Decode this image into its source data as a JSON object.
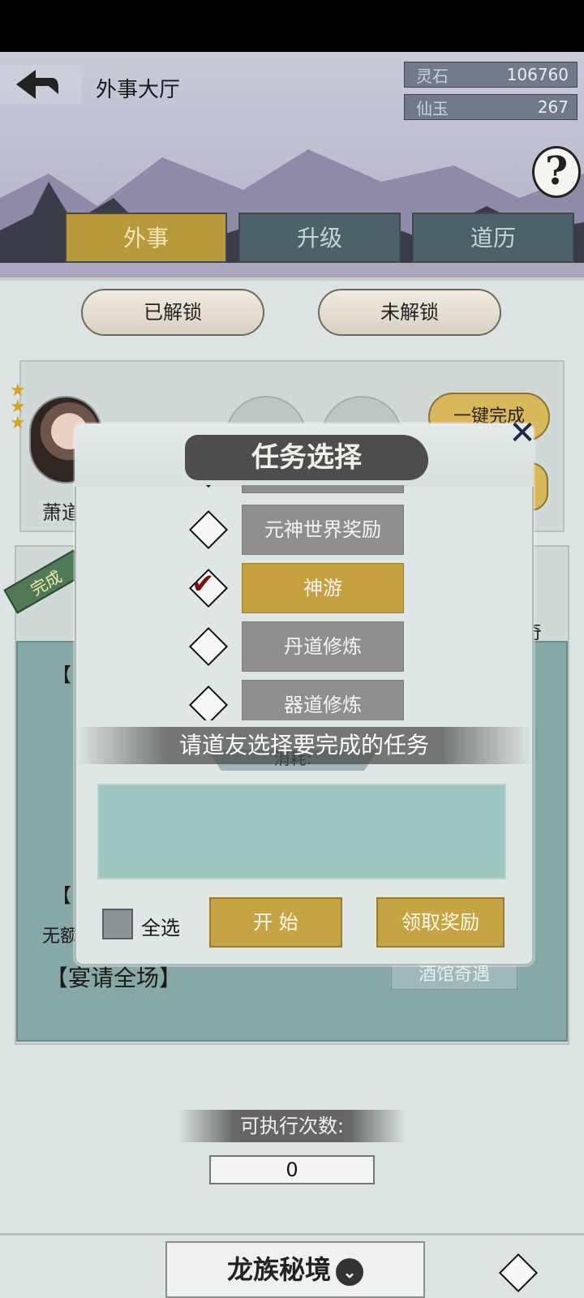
{
  "header": {
    "title": "外事大厅"
  },
  "currencies": [
    {
      "label": "灵石",
      "value": "106760"
    },
    {
      "label": "仙玉",
      "value": "267"
    }
  ],
  "help_glyph": "?",
  "tabs": [
    {
      "label": "外事",
      "active": true
    },
    {
      "label": "升级",
      "active": false
    },
    {
      "label": "道历",
      "active": false
    }
  ],
  "filters": {
    "unlocked": "已解锁",
    "locked": "未解锁"
  },
  "hero": {
    "name": "萧道",
    "stars": 3,
    "onekey_label": "一键完成"
  },
  "task": {
    "done_badge": "完成",
    "bracket_open": "【",
    "no_extra": "无额",
    "banquet": "【宴请全场】",
    "tavern_button": "酒馆奇遇",
    "side_char": "奇"
  },
  "exec": {
    "label": "可执行次数:",
    "count": "0"
  },
  "bottom": {
    "dragon_label": "龙族秘境",
    "dragon_arrow": "⌄"
  },
  "modal": {
    "title": "任务选择",
    "close_glyph": "✕",
    "options": [
      {
        "label": "元神世界奖励",
        "checked": false
      },
      {
        "label": "神游",
        "checked": true
      },
      {
        "label": "丹道修炼",
        "checked": false
      },
      {
        "label": "器道修炼",
        "checked": false
      }
    ],
    "toast": "请道友选择要完成的任务",
    "consume_label": "消耗:",
    "select_all_label": "全选",
    "start_label": "开 始",
    "claim_label": "领取奖励"
  },
  "colors": {
    "gold": "#c4a03e",
    "tab_active": "#b99a3a",
    "teal": "#4b6266"
  }
}
